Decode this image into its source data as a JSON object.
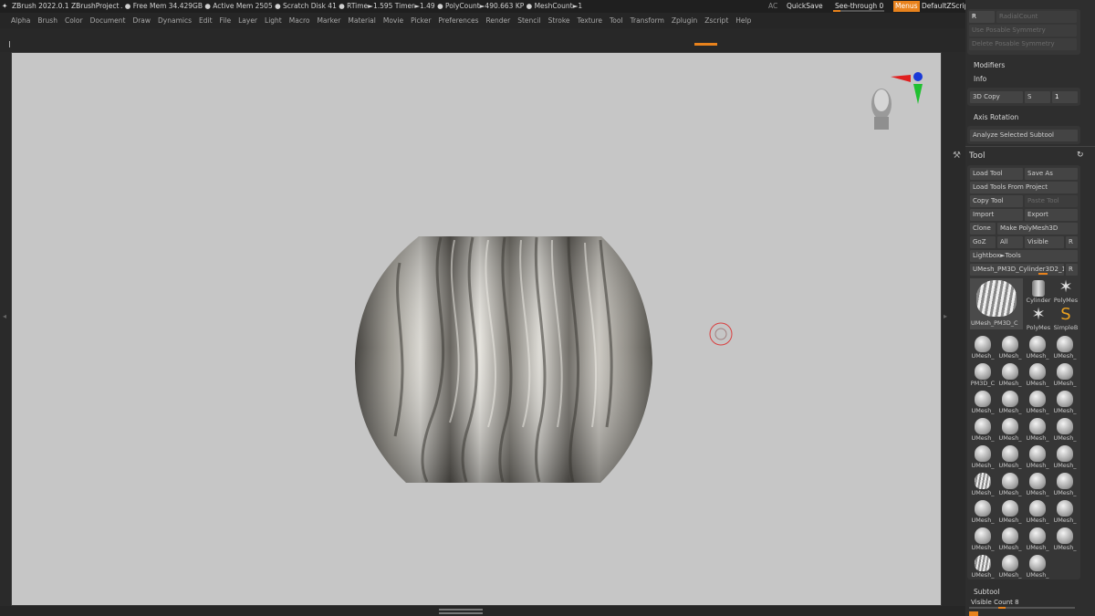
{
  "titlebar": {
    "app": "ZBrush 2022.0.1",
    "project": "ZBrushProject",
    "stats": ". ● Free Mem 34.429GB ● Active Mem 2505 ● Scratch Disk 41 ●  RTime►1.595 Timer►1.49 ● PolyCount►490.663 KP  ● MeshCount►1",
    "ac": "AC",
    "quicksave": "QuickSave",
    "seethrough": "See-through  0",
    "menus": "Menus",
    "script": "DefaultZScript"
  },
  "menubar": [
    "Alpha",
    "Brush",
    "Color",
    "Document",
    "Draw",
    "Dynamics",
    "Edit",
    "File",
    "Layer",
    "Light",
    "Macro",
    "Marker",
    "Material",
    "Movie",
    "Picker",
    "Preferences",
    "Render",
    "Stencil",
    "Stroke",
    "Texture",
    "Tool",
    "Transform",
    "Zplugin",
    "Zscript",
    "Help"
  ],
  "panel": {
    "top_items": [
      "RadialCount",
      "Use Posable Symmetry",
      "Delete Posable Symmetry"
    ],
    "modifiers": "Modifiers",
    "info": "Info",
    "copy3d": "3D Copy",
    "s": "S",
    "s_value": "1",
    "axis_rotation": "Axis Rotation",
    "analyze": "Analyze Selected Subtool",
    "tool_title": "Tool",
    "load_tool": "Load Tool",
    "save_as": "Save As",
    "load_from_project": "Load Tools From Project",
    "copy_tool": "Copy Tool",
    "paste_tool": "Paste Tool",
    "import": "Import",
    "export": "Export",
    "clone": "Clone",
    "make_polymesh": "Make PolyMesh3D",
    "goz": "GoZ",
    "all": "All",
    "visible": "Visible",
    "r": "R",
    "lightbox": "Lightbox►Tools",
    "current_tool": "UMesh_PM3D_Cylinder3D2_1",
    "r2": "R",
    "big_thumb_label": "UMesh_PM3D_C",
    "small_thumbs": [
      "Cylinder",
      "PolyMes",
      "PolyMes",
      "SimpleB"
    ],
    "grid_labels": [
      "UMesh_",
      "UMesh_",
      "UMesh_",
      "UMesh_",
      "PM3D_C",
      "UMesh_",
      "UMesh_",
      "UMesh_",
      "UMesh_",
      "UMesh_",
      "UMesh_",
      "UMesh_",
      "UMesh_",
      "UMesh_",
      "UMesh_",
      "UMesh_",
      "UMesh_",
      "UMesh_",
      "UMesh_",
      "UMesh_",
      "UMesh_",
      "UMesh_",
      "UMesh_",
      "UMesh_",
      "UMesh_",
      "UMesh_",
      "UMesh_",
      "UMesh_",
      "UMesh_",
      "UMesh_",
      "UMesh_",
      "UMesh_",
      "UMesh_",
      "UMesh_",
      "UMesh_"
    ],
    "subtool": "Subtool",
    "visible_count": "Visible Count 8"
  },
  "colors": {
    "accent": "#e8821c",
    "viewport": "#c6c6c6",
    "panel": "#2e2e2e"
  },
  "icons": [
    "head-gizmo-icon",
    "axis-gizmo-icon",
    "cursor-ring-icon",
    "tool-wrench-icon",
    "refresh-icon"
  ]
}
